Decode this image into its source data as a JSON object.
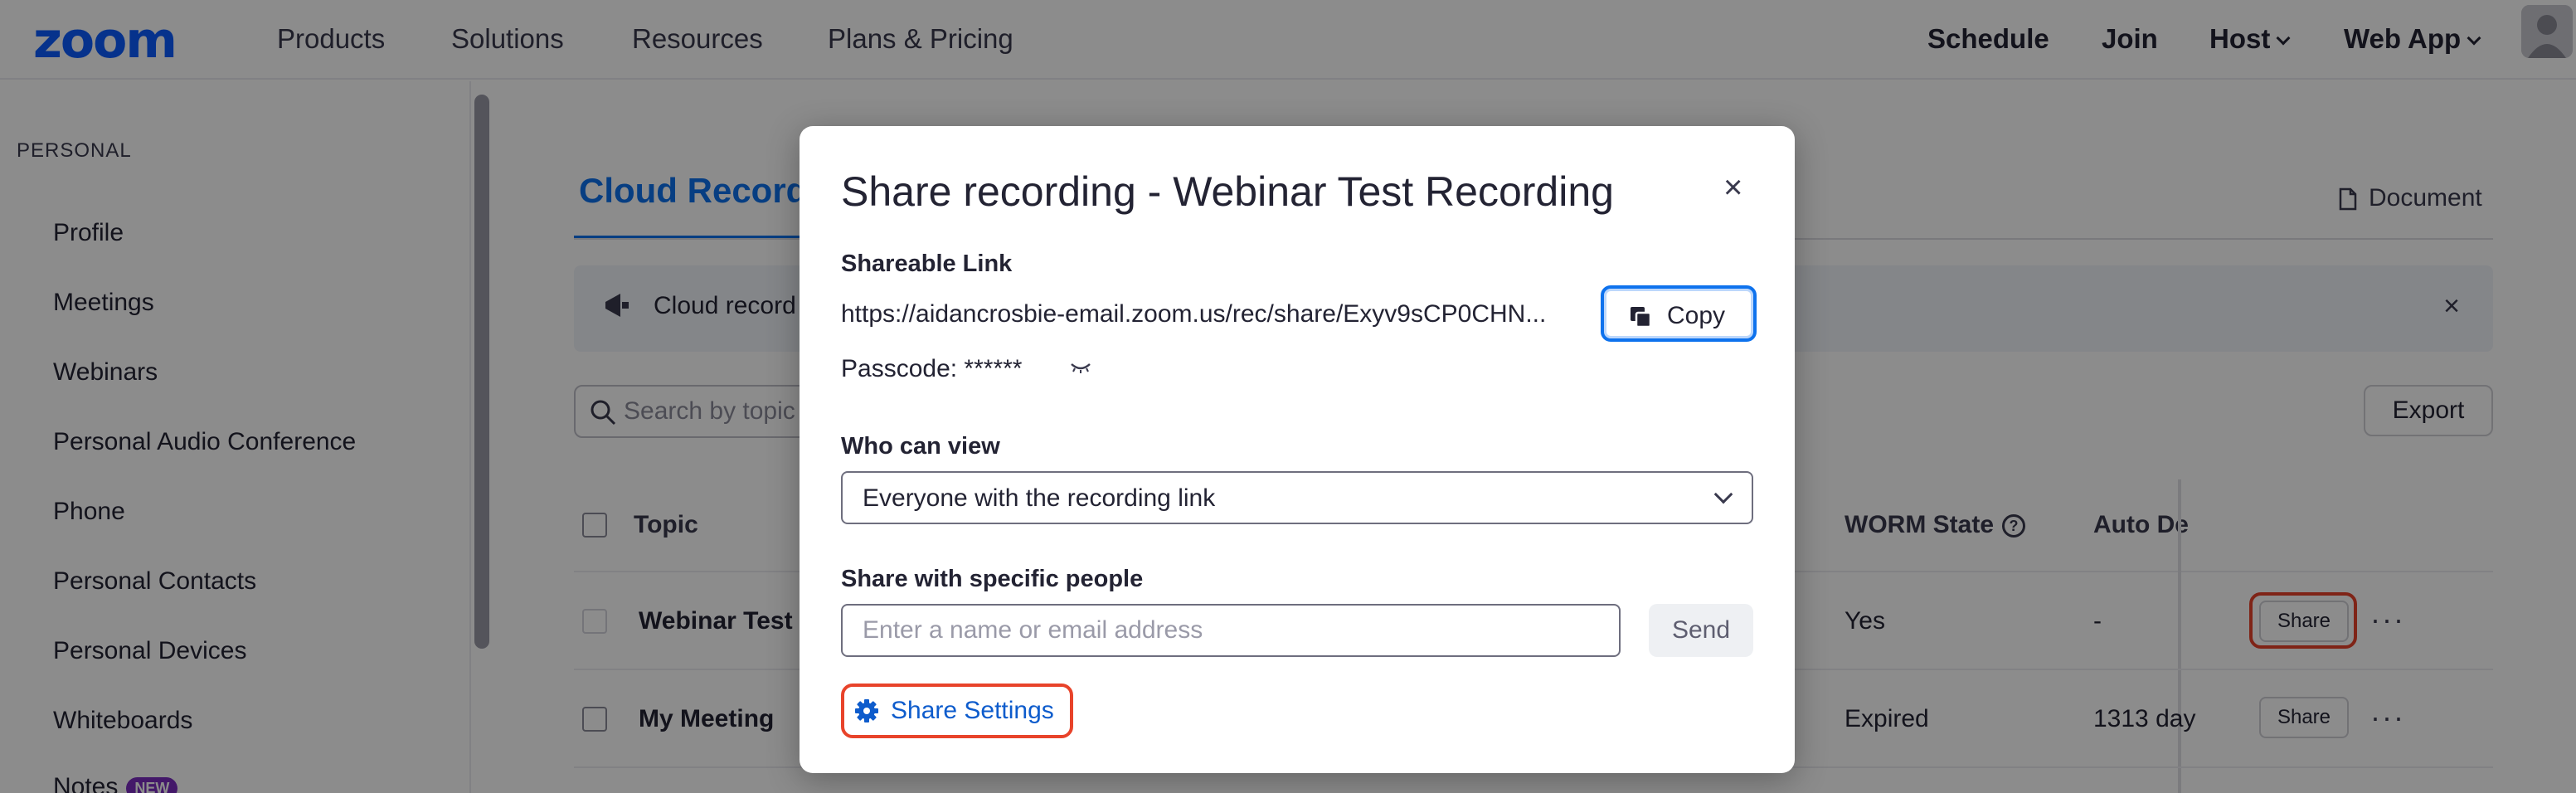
{
  "topnav": {
    "logo": "zoom",
    "left_items": [
      "Products",
      "Solutions",
      "Resources",
      "Plans & Pricing"
    ],
    "schedule": "Schedule",
    "join": "Join",
    "host": "Host",
    "web_app": "Web App"
  },
  "sidebar": {
    "heading": "PERSONAL",
    "items": [
      {
        "label": "Profile"
      },
      {
        "label": "Meetings"
      },
      {
        "label": "Webinars"
      },
      {
        "label": "Personal Audio Conference"
      },
      {
        "label": "Phone"
      },
      {
        "label": "Personal Contacts"
      },
      {
        "label": "Personal Devices"
      },
      {
        "label": "Whiteboards"
      },
      {
        "label": "Notes",
        "badge": "NEW"
      }
    ]
  },
  "main": {
    "tab_label": "Cloud Recordings",
    "document_link": "Document",
    "banner_text": "Cloud record",
    "search_placeholder": "Search by topic",
    "export_label": "Export",
    "columns": {
      "topic": "Topic",
      "worm_state": "WORM State",
      "auto_delete": "Auto De"
    },
    "rows": [
      {
        "topic": "Webinar Test I",
        "worm_state": "Yes",
        "auto_delete": "-",
        "share_label": "Share",
        "more": "···"
      },
      {
        "topic": "My Meeting",
        "worm_state": "Expired",
        "auto_delete": "1313 day",
        "share_label": "Share",
        "more": "···"
      }
    ]
  },
  "modal": {
    "title": "Share recording - Webinar Test Recording",
    "close": "×",
    "shareable_link_label": "Shareable Link",
    "shareable_link": "https://aidancrosbie-email.zoom.us/rec/share/Exyv9sCP0CHN...",
    "copy_label": "Copy",
    "passcode": "Passcode: ******",
    "eye_glyph": "ᨓ",
    "who_can_view_label": "Who can view",
    "who_can_view_value": "Everyone with the recording link",
    "share_with_people_label": "Share with specific people",
    "people_placeholder": "Enter a name or email address",
    "send_label": "Send",
    "share_settings_label": "Share Settings"
  },
  "colors": {
    "brand": "#0b5cff",
    "link": "#0e72ed",
    "highlight": "#e8432a"
  }
}
